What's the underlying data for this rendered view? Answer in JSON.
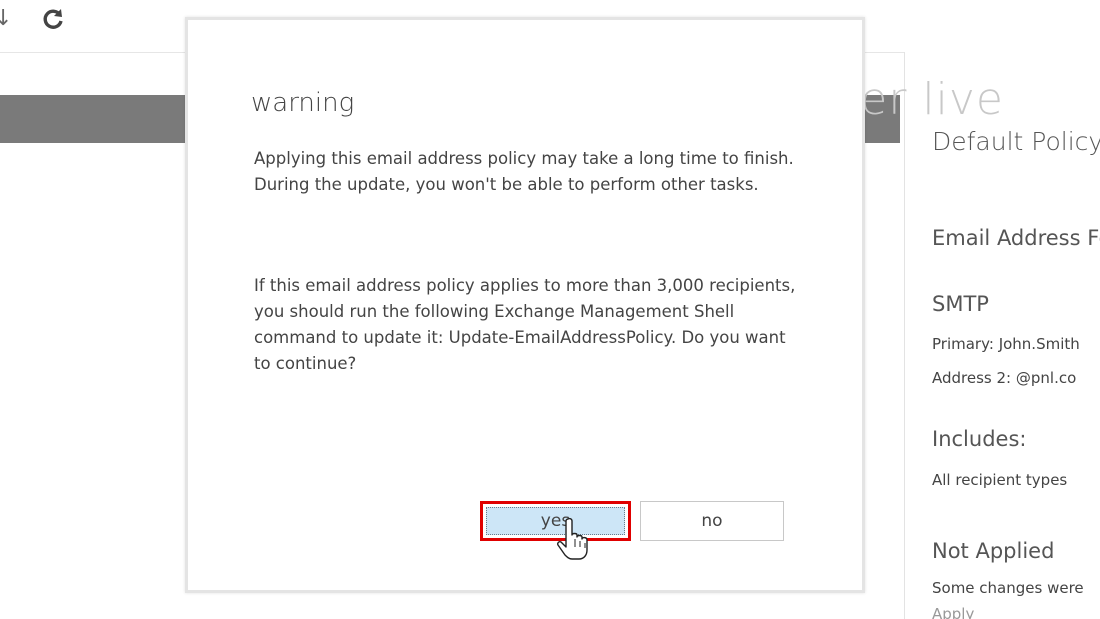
{
  "toolbar": {
    "download_icon_glyph": "↓",
    "refresh_icon_glyph": "⟳",
    "icons": [
      "download-icon",
      "refresh-icon"
    ]
  },
  "watermark": {
    "text": "peter  live"
  },
  "right_pane": {
    "title": "Default Policy",
    "section_email": "Email Address Fo",
    "section_smtp": "SMTP",
    "primary": "Primary: John.Smith",
    "address2": "Address 2: @pnl.co",
    "includes_label": "Includes:",
    "includes_value": "All recipient types",
    "status_heading": "Not Applied",
    "status_text": "Some changes were",
    "apply_link": "Apply"
  },
  "dialog": {
    "title": "warning",
    "paragraph1": "Applying this email address policy may take a long time to finish. During the update, you won't be able to perform other tasks.",
    "paragraph2": "If this email address policy applies to more than 3,000 recipients, you should run the following Exchange Management Shell command to update it: Update-EmailAddressPolicy. Do you want to continue?",
    "yes_label": "yes",
    "no_label": "no"
  },
  "colors": {
    "highlight_border": "#e00000",
    "yes_button_fill": "#cde6f7",
    "header_bar": "#7a7a7a",
    "watermark": "#c8c8c8",
    "watermark_logo": "#d29b88"
  }
}
